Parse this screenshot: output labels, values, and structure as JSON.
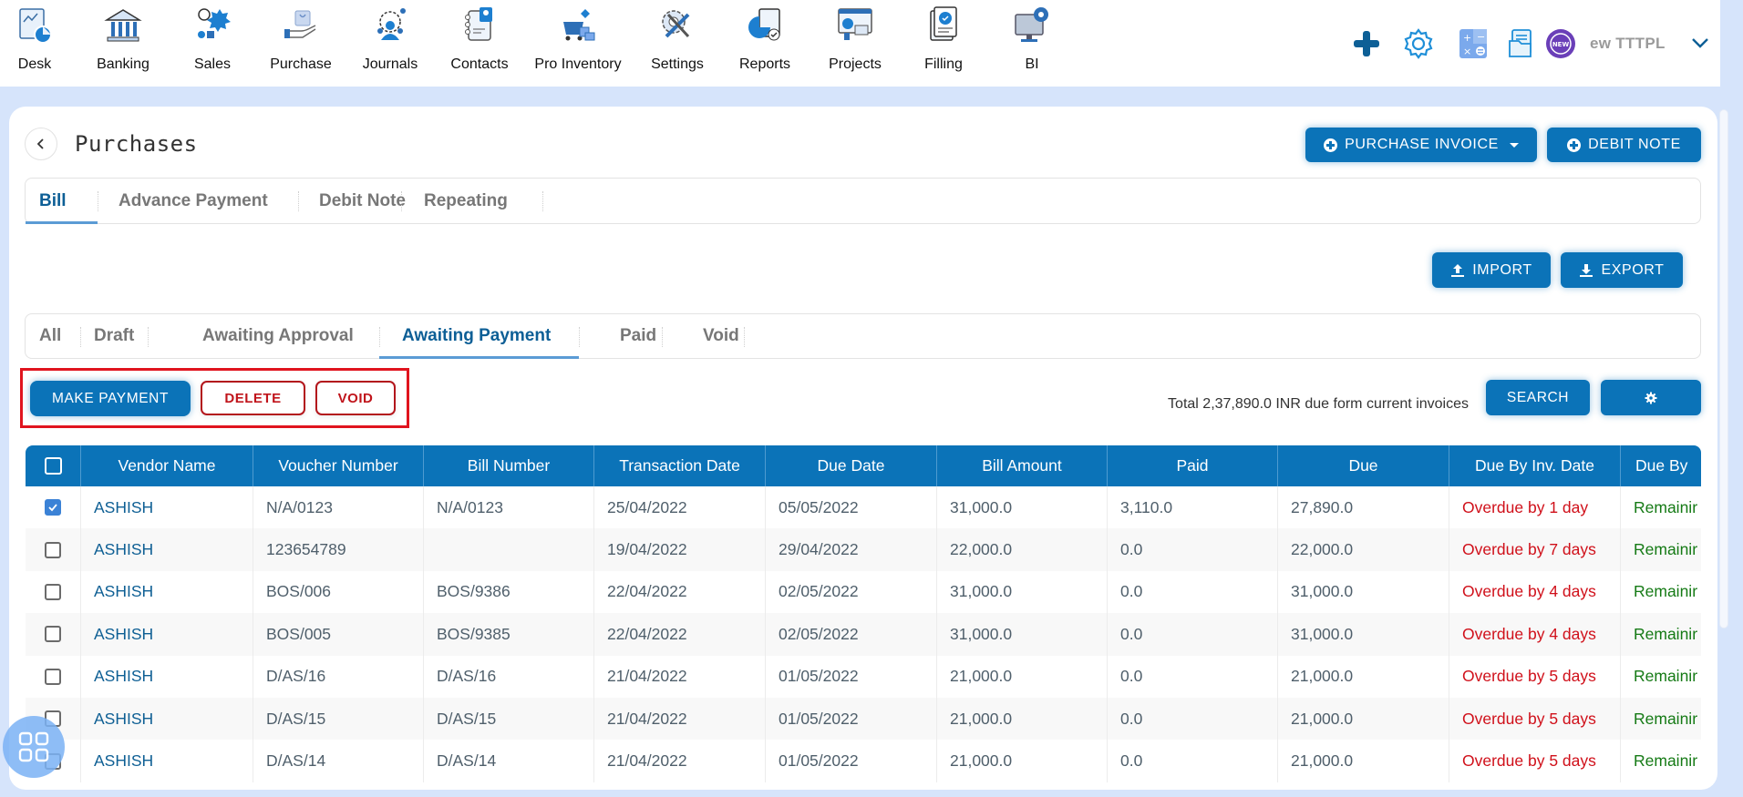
{
  "nav": {
    "items": [
      {
        "label": "Desk",
        "icon": "desk-icon"
      },
      {
        "label": "Banking",
        "icon": "bank-icon"
      },
      {
        "label": "Sales",
        "icon": "sales-icon"
      },
      {
        "label": "Purchase",
        "icon": "purchase-icon"
      },
      {
        "label": "Journals",
        "icon": "journals-icon"
      },
      {
        "label": "Contacts",
        "icon": "contacts-icon"
      },
      {
        "label": "Pro Inventory",
        "icon": "inventory-icon"
      },
      {
        "label": "Settings",
        "icon": "settings-icon"
      },
      {
        "label": "Reports",
        "icon": "reports-icon"
      },
      {
        "label": "Projects",
        "icon": "projects-icon"
      },
      {
        "label": "Filling",
        "icon": "filling-icon"
      },
      {
        "label": "BI",
        "icon": "bi-icon"
      }
    ],
    "tools": [
      "plus-icon",
      "gear-icon",
      "calculator-icon",
      "document-icon",
      "new-badge-icon"
    ],
    "new_badge_text": "NEW",
    "company": "ew TTTPL"
  },
  "page": {
    "title": "Purchases",
    "purchase_invoice_label": "PURCHASE INVOICE",
    "debit_note_label": "DEBIT NOTE",
    "import_label": "IMPORT",
    "export_label": "EXPORT"
  },
  "doc_tabs": [
    {
      "label": "Bill",
      "active": true
    },
    {
      "label": "Advance Payment",
      "active": false
    },
    {
      "label": "Debit Note",
      "active": false
    },
    {
      "label": "Repeating",
      "active": false
    }
  ],
  "status_tabs": [
    {
      "label": "All",
      "active": false
    },
    {
      "label": "Draft",
      "active": false
    },
    {
      "label": "Awaiting Approval",
      "active": false
    },
    {
      "label": "Awaiting Payment",
      "active": true
    },
    {
      "label": "Paid",
      "active": false
    },
    {
      "label": "Void",
      "active": false
    }
  ],
  "actions": {
    "make_payment": "MAKE PAYMENT",
    "delete": "DELETE",
    "void": "VOID",
    "search": "SEARCH",
    "total_text": "Total 2,37,890.0 INR due form current invoices"
  },
  "colors": {
    "primary": "#0b73b8",
    "danger": "#c0141b",
    "overdue": "#d0101a",
    "remaining": "#157a15",
    "highlight_box": "#e0141e"
  },
  "table": {
    "columns": [
      "Vendor Name",
      "Voucher Number",
      "Bill Number",
      "Transaction Date",
      "Due Date",
      "Bill Amount",
      "Paid",
      "Due",
      "Due By Inv. Date",
      "Due By"
    ],
    "rows": [
      {
        "checked": true,
        "cells": [
          "ASHISH",
          "N/A/0123",
          "N/A/0123",
          "25/04/2022",
          "05/05/2022",
          "31,000.0",
          "3,110.0",
          "27,890.0",
          "Overdue by 1 day",
          "Remainir"
        ]
      },
      {
        "checked": false,
        "cells": [
          "ASHISH",
          "123654789",
          "",
          "19/04/2022",
          "29/04/2022",
          "22,000.0",
          "0.0",
          "22,000.0",
          "Overdue by 7 days",
          "Remainir"
        ]
      },
      {
        "checked": false,
        "cells": [
          "ASHISH",
          "BOS/006",
          "BOS/9386",
          "22/04/2022",
          "02/05/2022",
          "31,000.0",
          "0.0",
          "31,000.0",
          "Overdue by 4 days",
          "Remainir"
        ]
      },
      {
        "checked": false,
        "cells": [
          "ASHISH",
          "BOS/005",
          "BOS/9385",
          "22/04/2022",
          "02/05/2022",
          "31,000.0",
          "0.0",
          "31,000.0",
          "Overdue by 4 days",
          "Remainir"
        ]
      },
      {
        "checked": false,
        "cells": [
          "ASHISH",
          "D/AS/16",
          "D/AS/16",
          "21/04/2022",
          "01/05/2022",
          "21,000.0",
          "0.0",
          "21,000.0",
          "Overdue by 5 days",
          "Remainir"
        ]
      },
      {
        "checked": false,
        "cells": [
          "ASHISH",
          "D/AS/15",
          "D/AS/15",
          "21/04/2022",
          "01/05/2022",
          "21,000.0",
          "0.0",
          "21,000.0",
          "Overdue by 5 days",
          "Remainir"
        ]
      },
      {
        "checked": false,
        "cells": [
          "ASHISH",
          "D/AS/14",
          "D/AS/14",
          "21/04/2022",
          "01/05/2022",
          "21,000.0",
          "0.0",
          "21,000.0",
          "Overdue by 5 days",
          "Remainir"
        ]
      }
    ]
  }
}
